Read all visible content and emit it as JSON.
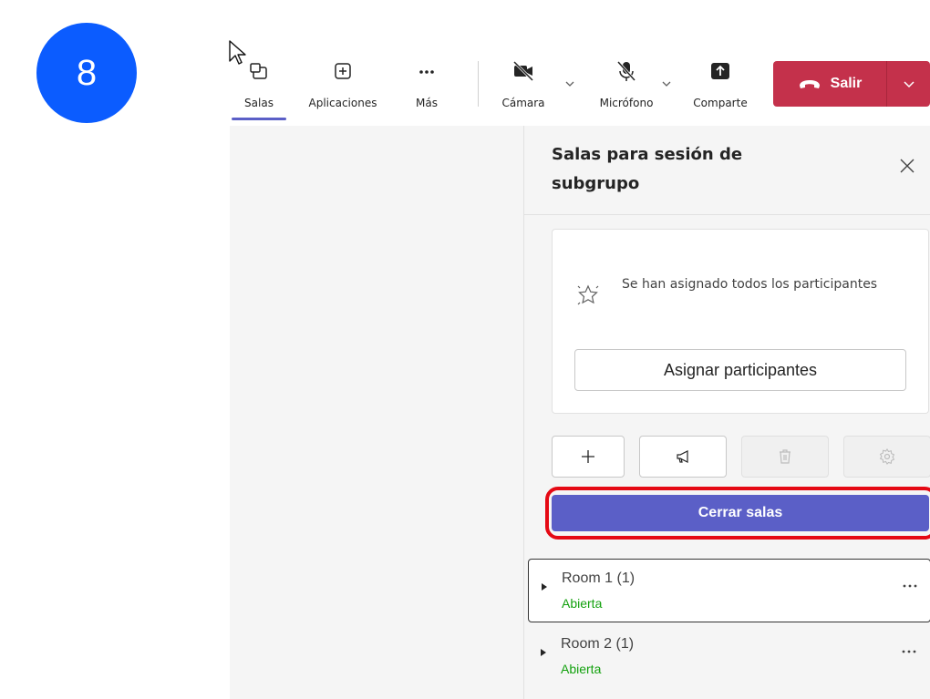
{
  "step": {
    "number": "8"
  },
  "toolbar": {
    "rooms_label": "Salas",
    "apps_label": "Aplicaciones",
    "more_label": "Más",
    "camera_label": "Cámara",
    "mic_label": "Micrófono",
    "share_label": "Comparte",
    "leave_label": "Salir"
  },
  "panel": {
    "title": "Salas para sesión de subgrupo",
    "assigned_message": "Se han asignado todos los participantes",
    "assign_button": "Asignar participantes",
    "close_rooms_button": "Cerrar salas",
    "rooms": [
      {
        "name": "Room 1",
        "count": "(1)",
        "status": "Abierta"
      },
      {
        "name": "Room 2",
        "count": "(1)",
        "status": "Abierta"
      }
    ]
  },
  "colors": {
    "accent": "#5b5fc7",
    "leave": "#c4314b",
    "step_badge": "#0b5cff",
    "highlight": "#e50914",
    "status_open": "#13a10e"
  }
}
